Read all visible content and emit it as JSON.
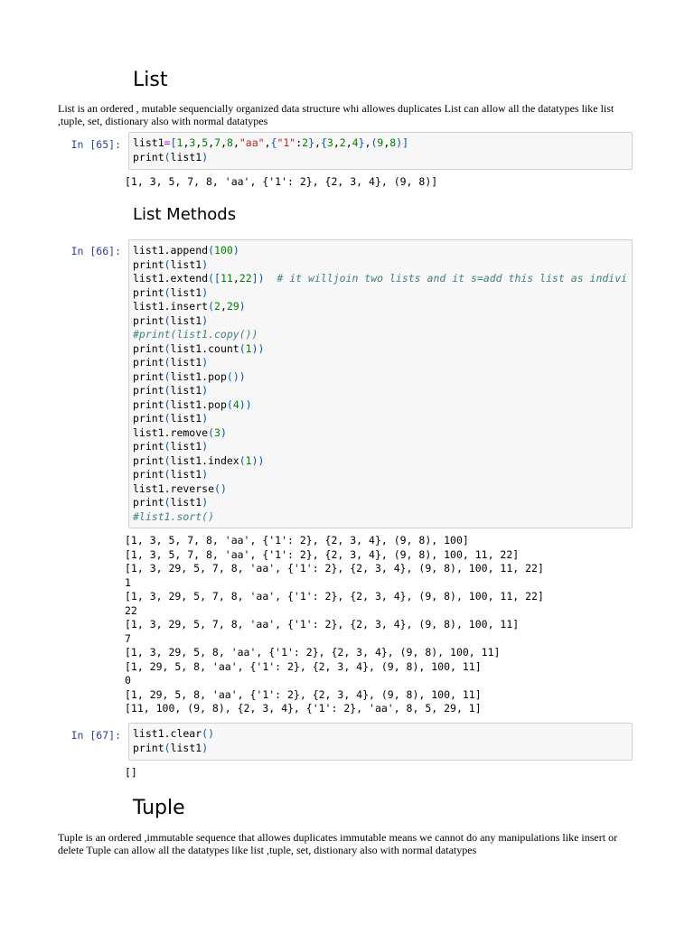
{
  "list_section": {
    "title": "List",
    "description": "List is an ordered , mutable sequencially organized data structure whi allowes duplicates List can allow all the datatypes like list ,tuple, set, distionary also with normal datatypes"
  },
  "cells": [
    {
      "prompt": "In [65]:",
      "code": [
        "list1=[1,3,5,7,8,\"aa\",{\"1\":2},{3,2,4},(9,8)]",
        "print(list1)"
      ],
      "output": [
        "[1, 3, 5, 7, 8, 'aa', {'1': 2}, {2, 3, 4}, (9, 8)]"
      ]
    },
    {
      "prompt": "In [66]:",
      "code": [
        "list1.append(100)",
        "print(list1)",
        "list1.extend([11,22])  # it willjoin two lists and it s=add this list as indivi",
        "print(list1)",
        "list1.insert(2,29)",
        "print(list1)",
        "#print(list1.copy())",
        "print(list1.count(1))",
        "print(list1)",
        "print(list1.pop())",
        "print(list1)",
        "print(list1.pop(4))",
        "print(list1)",
        "list1.remove(3)",
        "print(list1)",
        "print(list1.index(1))",
        "print(list1)",
        "list1.reverse()",
        "print(list1)",
        "#list1.sort()"
      ],
      "output": [
        "[1, 3, 5, 7, 8, 'aa', {'1': 2}, {2, 3, 4}, (9, 8), 100]",
        "[1, 3, 5, 7, 8, 'aa', {'1': 2}, {2, 3, 4}, (9, 8), 100, 11, 22]",
        "[1, 3, 29, 5, 7, 8, 'aa', {'1': 2}, {2, 3, 4}, (9, 8), 100, 11, 22]",
        "1",
        "[1, 3, 29, 5, 7, 8, 'aa', {'1': 2}, {2, 3, 4}, (9, 8), 100, 11, 22]",
        "22",
        "[1, 3, 29, 5, 7, 8, 'aa', {'1': 2}, {2, 3, 4}, (9, 8), 100, 11]",
        "7",
        "[1, 3, 29, 5, 8, 'aa', {'1': 2}, {2, 3, 4}, (9, 8), 100, 11]",
        "[1, 29, 5, 8, 'aa', {'1': 2}, {2, 3, 4}, (9, 8), 100, 11]",
        "0",
        "[1, 29, 5, 8, 'aa', {'1': 2}, {2, 3, 4}, (9, 8), 100, 11]",
        "[11, 100, (9, 8), {2, 3, 4}, {'1': 2}, 'aa', 8, 5, 29, 1]"
      ]
    },
    {
      "prompt": "In [67]:",
      "code": [
        "list1.clear()",
        "print(list1)"
      ],
      "output": [
        "[]"
      ]
    }
  ],
  "methods_section": {
    "title": "List Methods"
  },
  "tuple_section": {
    "title": "Tuple",
    "description": "Tuple is an ordered ,immutable sequence that allowes duplicates immutable means we cannot do any manipulations like insert or delete Tuple can allow all the datatypes like list ,tuple, set, distionary also with normal datatypes"
  }
}
